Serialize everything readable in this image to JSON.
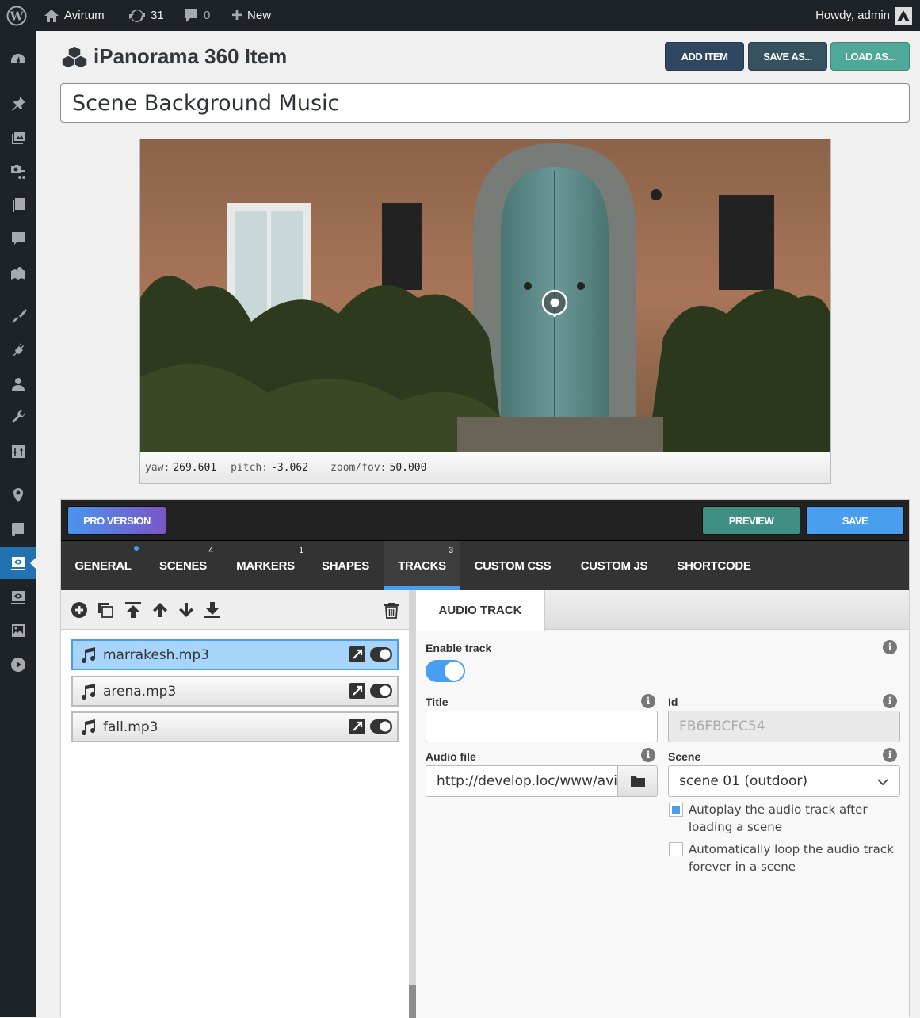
{
  "adminbar": {
    "site_name": "Avirtum",
    "updates_count": "31",
    "comments_count": "0",
    "new_label": "New",
    "greeting": "Howdy, admin"
  },
  "sidebar": {
    "items": [
      {
        "icon": "dashboard-icon"
      },
      {
        "icon": "pin-icon"
      },
      {
        "icon": "media-icon"
      },
      {
        "icon": "camera-music-icon"
      },
      {
        "icon": "pages-icon"
      },
      {
        "icon": "comments-icon"
      },
      {
        "icon": "map-icon"
      },
      {
        "icon": "appearance-icon"
      },
      {
        "icon": "plugins-icon"
      },
      {
        "icon": "users-icon"
      },
      {
        "icon": "tools-icon"
      },
      {
        "icon": "settings-icon"
      },
      {
        "icon": "location-icon"
      },
      {
        "icon": "book-icon"
      },
      {
        "icon": "ipanorama-icon",
        "active": true
      },
      {
        "icon": "ipanorama-alt-icon"
      },
      {
        "icon": "image-icon"
      },
      {
        "icon": "play-icon"
      }
    ]
  },
  "header": {
    "title": "iPanorama 360 Item",
    "add_item": "ADD ITEM",
    "save_as": "SAVE AS...",
    "load_as": "LOAD AS...",
    "item_name": "Scene Background Music"
  },
  "viewer": {
    "yaw_label": "yaw:",
    "yaw": "269.601",
    "pitch_label": "pitch:",
    "pitch": "-3.062",
    "fov_label": "zoom/fov:",
    "fov": "50.000"
  },
  "editor": {
    "pro_version": "PRO VERSION",
    "preview": "PREVIEW",
    "save": "SAVE",
    "tabs": [
      {
        "label": "GENERAL",
        "badge": ""
      },
      {
        "label": "SCENES",
        "badge": "4"
      },
      {
        "label": "MARKERS",
        "badge": "1"
      },
      {
        "label": "SHAPES",
        "badge": ""
      },
      {
        "label": "TRACKS",
        "badge": "3"
      },
      {
        "label": "CUSTOM CSS",
        "badge": ""
      },
      {
        "label": "CUSTOM JS",
        "badge": ""
      },
      {
        "label": "SHORTCODE",
        "badge": ""
      }
    ],
    "active_tab": "TRACKS",
    "tracks": [
      {
        "name": "marrakesh.mp3",
        "selected": true
      },
      {
        "name": "arena.mp3",
        "selected": false
      },
      {
        "name": "fall.mp3",
        "selected": false
      }
    ],
    "panel": {
      "tab": "AUDIO TRACK",
      "enable_label": "Enable track",
      "enabled": true,
      "title_label": "Title",
      "title_value": "",
      "id_label": "Id",
      "id_value": "FB6FBCFC54",
      "audio_label": "Audio file",
      "audio_value": "http://develop.loc/www/avirtum",
      "scene_label": "Scene",
      "scene_value": "scene 01 (outdoor)",
      "autoplay_label": "Autoplay the audio track after loading a scene",
      "autoplay": true,
      "loop_label": "Automatically loop the audio track forever in a scene",
      "loop": false
    }
  },
  "colors": {
    "accent": "#4a9ef0",
    "add_item": "#2f4760",
    "save_as": "#35525e",
    "load_as": "#4fa898",
    "preview": "#3f8f82",
    "save": "#4a9ef0",
    "wp_active": "#2271b1"
  }
}
